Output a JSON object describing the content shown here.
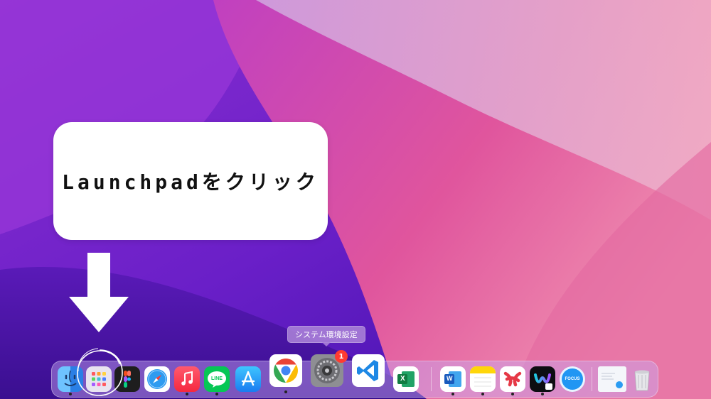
{
  "callout": {
    "text": "Launchpadをクリック"
  },
  "tooltip": {
    "text": "システム環境設定"
  },
  "dock": {
    "items": [
      {
        "id": "finder",
        "icon": "finder-icon"
      },
      {
        "id": "launchpad",
        "icon": "launchpad-icon"
      },
      {
        "id": "figma",
        "icon": "figma-icon"
      },
      {
        "id": "safari",
        "icon": "safari-icon"
      },
      {
        "id": "music",
        "icon": "music-icon"
      },
      {
        "id": "line",
        "icon": "line-icon",
        "label": "LINE"
      },
      {
        "id": "app-store",
        "icon": "app-store-icon"
      },
      {
        "id": "chrome",
        "icon": "chrome-icon"
      },
      {
        "id": "system-preferences",
        "icon": "system-preferences-icon",
        "badge": "1"
      },
      {
        "id": "vscode",
        "icon": "vscode-icon"
      },
      {
        "id": "excel",
        "icon": "excel-icon",
        "label": "X"
      },
      {
        "id": "word",
        "icon": "word-icon",
        "label": "W"
      },
      {
        "id": "notes",
        "icon": "notes-icon"
      },
      {
        "id": "xmind",
        "icon": "xmind-icon"
      },
      {
        "id": "webex",
        "icon": "webex-icon"
      },
      {
        "id": "focus",
        "icon": "focus-icon",
        "label": "FOCUS"
      },
      {
        "id": "preview-document",
        "icon": "document-icon"
      },
      {
        "id": "trash",
        "icon": "trash-icon"
      }
    ]
  },
  "colors": {
    "wallpaper_purple": "#6a1fc8",
    "wallpaper_pink": "#e0559d",
    "callout_bg": "#ffffff",
    "arrow": "#ffffff",
    "badge": "#ff3b30"
  }
}
